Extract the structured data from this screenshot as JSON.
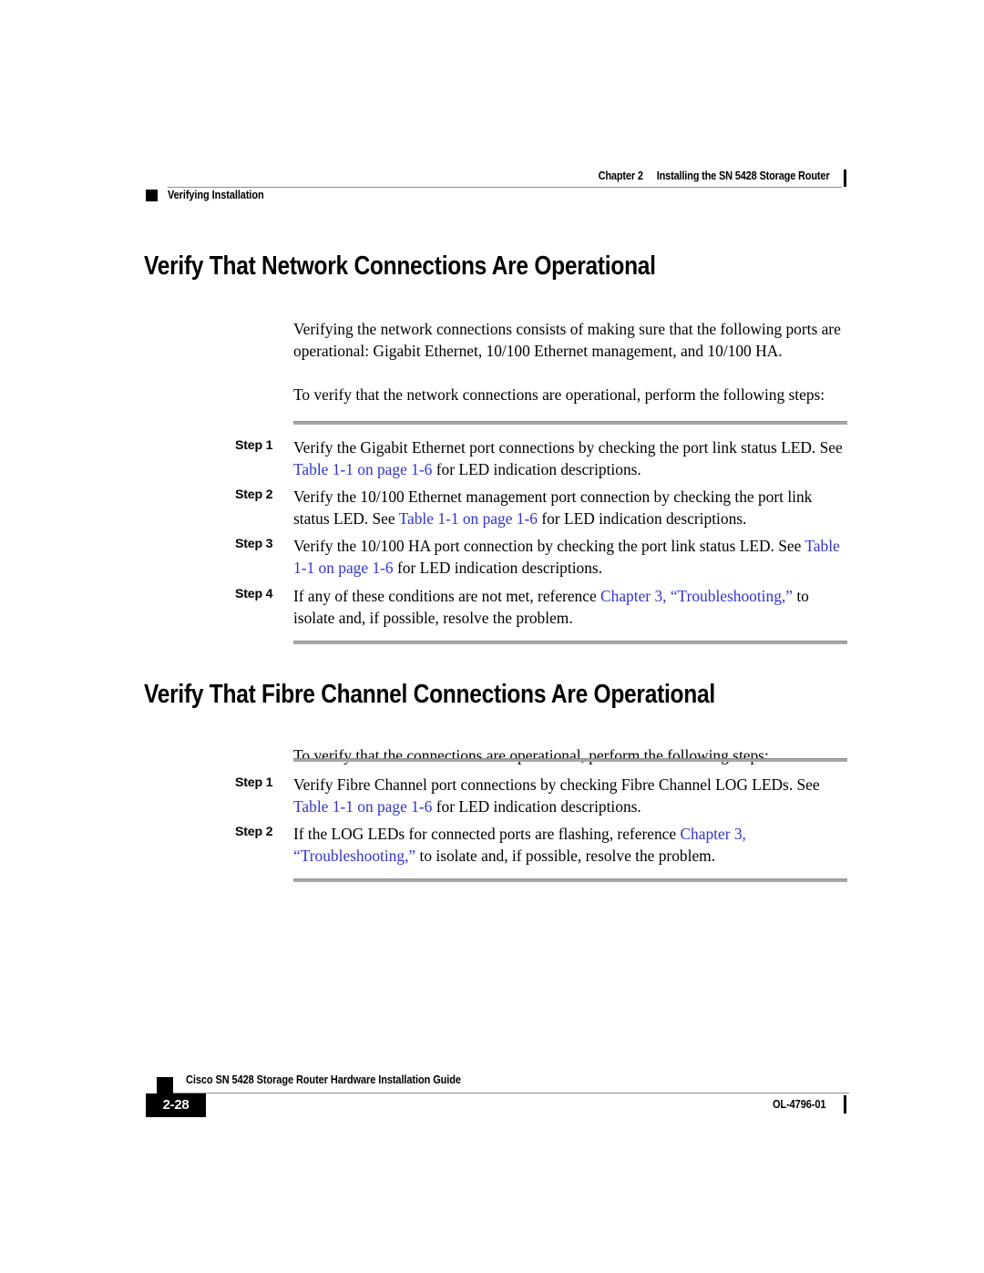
{
  "header": {
    "chapter_number": "Chapter 2",
    "chapter_title": "Installing the SN 5428 Storage Router",
    "running_section": "Verifying Installation"
  },
  "sections": [
    {
      "heading": "Verify That Network Connections Are Operational",
      "paragraphs": [
        "Verifying the network connections consists of making sure that the following ports are operational: Gigabit Ethernet, 10/100 Ethernet management, and 10/100 HA.",
        "To verify that the network connections are operational, perform the following steps:"
      ],
      "steps": [
        {
          "label": "Step 1",
          "parts": [
            {
              "text": "Verify the Gigabit Ethernet port connections by checking the port link status LED. See ",
              "link": false
            },
            {
              "text": "Table 1-1 on page 1-6",
              "link": true
            },
            {
              "text": " for LED indication descriptions.",
              "link": false
            }
          ]
        },
        {
          "label": "Step 2",
          "parts": [
            {
              "text": "Verify the 10/100 Ethernet management port connection by checking the port link status LED. See ",
              "link": false
            },
            {
              "text": "Table 1-1 on page 1-6",
              "link": true
            },
            {
              "text": " for LED indication descriptions.",
              "link": false
            }
          ]
        },
        {
          "label": "Step 3",
          "parts": [
            {
              "text": "Verify the 10/100 HA port connection by checking the port link status LED. See ",
              "link": false
            },
            {
              "text": "Table 1-1 on page 1-6",
              "link": true
            },
            {
              "text": " for LED indication descriptions.",
              "link": false
            }
          ]
        },
        {
          "label": "Step 4",
          "parts": [
            {
              "text": "If any of these conditions are not met, reference ",
              "link": false
            },
            {
              "text": "Chapter 3, “Troubleshooting,”",
              "link": true
            },
            {
              "text": " to isolate and, if possible, resolve the problem.",
              "link": false
            }
          ]
        }
      ]
    },
    {
      "heading": "Verify That Fibre Channel Connections Are Operational",
      "paragraphs": [
        "To verify that the connections are operational, perform the following steps:"
      ],
      "steps": [
        {
          "label": "Step 1",
          "parts": [
            {
              "text": "Verify Fibre Channel port connections by checking Fibre Channel LOG LEDs. See ",
              "link": false
            },
            {
              "text": "Table 1-1 on page 1-6",
              "link": true
            },
            {
              "text": " for LED indication descriptions.",
              "link": false
            }
          ]
        },
        {
          "label": "Step 2",
          "parts": [
            {
              "text": "If the LOG LEDs for connected ports are flashing, reference ",
              "link": false
            },
            {
              "text": "Chapter 3, “Troubleshooting,”",
              "link": true
            },
            {
              "text": " to isolate and, if possible, resolve the problem.",
              "link": false
            }
          ]
        }
      ]
    }
  ],
  "footer": {
    "guide_title": "Cisco SN 5428 Storage Router Hardware Installation Guide",
    "page_number": "2-28",
    "document_id": "OL-4796-01"
  },
  "colors": {
    "link": "#3333CC",
    "rule": "#A8A8A8",
    "thin_rule": "#8C8C8C",
    "text": "#000000",
    "page_background": "#FFFFFF"
  }
}
